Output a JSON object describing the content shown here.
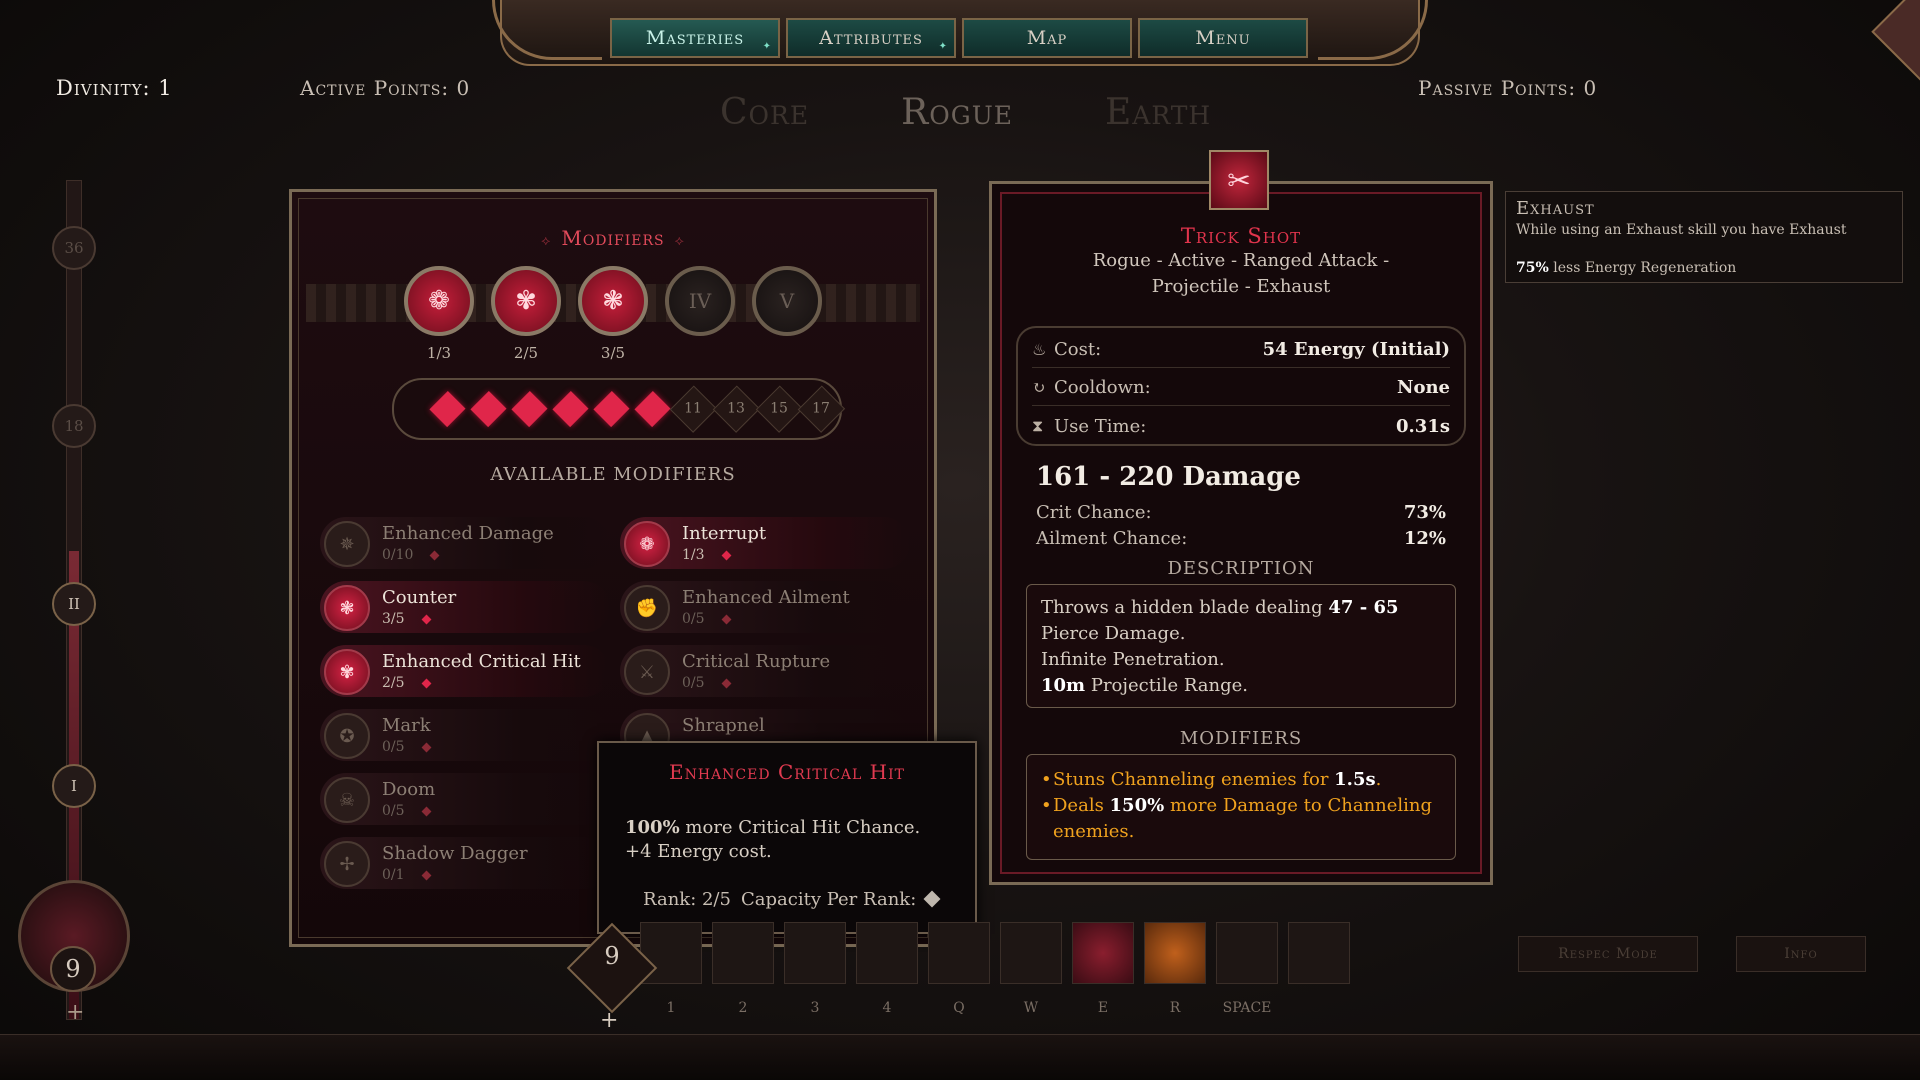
{
  "nav": {
    "tabs": [
      "Masteries",
      "Attributes",
      "Map",
      "Menu"
    ],
    "active": "Masteries"
  },
  "header": {
    "divinity": "Divinity: 1",
    "active_points": "Active Points: 0",
    "passive_points": "Passive Points: 0",
    "trees": [
      "Core",
      "Rogue",
      "Earth"
    ]
  },
  "progression": {
    "nodes": [
      "36",
      "18",
      "II",
      "I"
    ],
    "level": "9",
    "plus": "+"
  },
  "modifiers_panel": {
    "title": "Modifiers",
    "slots": [
      {
        "label": "",
        "rank": "1/3",
        "filled": true
      },
      {
        "label": "",
        "rank": "2/5",
        "filled": true
      },
      {
        "label": "",
        "rank": "3/5",
        "filled": true
      },
      {
        "label": "IV",
        "rank": "",
        "filled": false
      },
      {
        "label": "V",
        "rank": "",
        "filled": false
      }
    ],
    "capacity_filled": 6,
    "capacity_numbers": [
      "11",
      "13",
      "15",
      "17"
    ],
    "available_title": "AVAILABLE MODIFIERS",
    "modifiers": [
      {
        "name": "Enhanced Damage",
        "rank": "0/10"
      },
      {
        "name": "Interrupt",
        "rank": "1/3"
      },
      {
        "name": "Counter",
        "rank": "3/5"
      },
      {
        "name": "Enhanced Ailment",
        "rank": "0/5"
      },
      {
        "name": "Enhanced Critical Hit",
        "rank": "2/5"
      },
      {
        "name": "Critical Rupture",
        "rank": "0/5"
      },
      {
        "name": "Mark",
        "rank": "0/5"
      },
      {
        "name": "Shrapnel",
        "rank": ""
      },
      {
        "name": "Doom",
        "rank": "0/5"
      },
      {
        "name": "Shadow Dagger",
        "rank": "0/1"
      }
    ]
  },
  "tooltip": {
    "title": "Enhanced Critical Hit",
    "line1_strong": "100%",
    "line1": " more Critical Hit Chance.",
    "line2": "+4 Energy cost.",
    "rank": "Rank: 2/5",
    "capacity": "Capacity Per Rank:"
  },
  "skill": {
    "title": "Trick Shot",
    "tags": "Rogue - Active - Ranged Attack - Projectile - Exhaust",
    "cost_label": "Cost:",
    "cost_value": "54 Energy (Initial)",
    "cooldown_label": "Cooldown:",
    "cooldown_value": "None",
    "usetime_label": "Use Time:",
    "usetime_value": "0.31s",
    "damage": "161 - 220 Damage",
    "crit_label": "Crit Chance:",
    "crit_value": "73%",
    "ailment_label": "Ailment Chance:",
    "ailment_value": "12%",
    "description_title": "DESCRIPTION",
    "desc_1a": "Throws a hidden blade dealing ",
    "desc_1b": "47 - 65",
    "desc_1c": " Pierce Damage.",
    "desc_2": "Infinite Penetration.",
    "desc_3a": "10m",
    "desc_3b": " Projectile Range.",
    "modifiers_title": "MODIFIERS",
    "mod_1a": "Stuns Channeling enemies for ",
    "mod_1b": "1.5s",
    "mod_1c": ".",
    "mod_2a": "Deals ",
    "mod_2b": "150%",
    "mod_2c": " more Damage to Channeling enemies."
  },
  "exhaust": {
    "title": "Exhaust",
    "desc": "While using an Exhaust skill you have Exhaust",
    "effect_strong": "75%",
    "effect": " less Energy Regeneration"
  },
  "hotbar": {
    "points": "9",
    "plus": "+",
    "keys": [
      "1",
      "2",
      "3",
      "4",
      "Q",
      "W",
      "E",
      "R",
      "SPACE",
      ""
    ],
    "respec": "Respec Mode",
    "info": "Info"
  },
  "colors": {
    "accent_red": "#e0264a",
    "teal_tab": "#1d4a44",
    "gold": "#f0a21e"
  }
}
